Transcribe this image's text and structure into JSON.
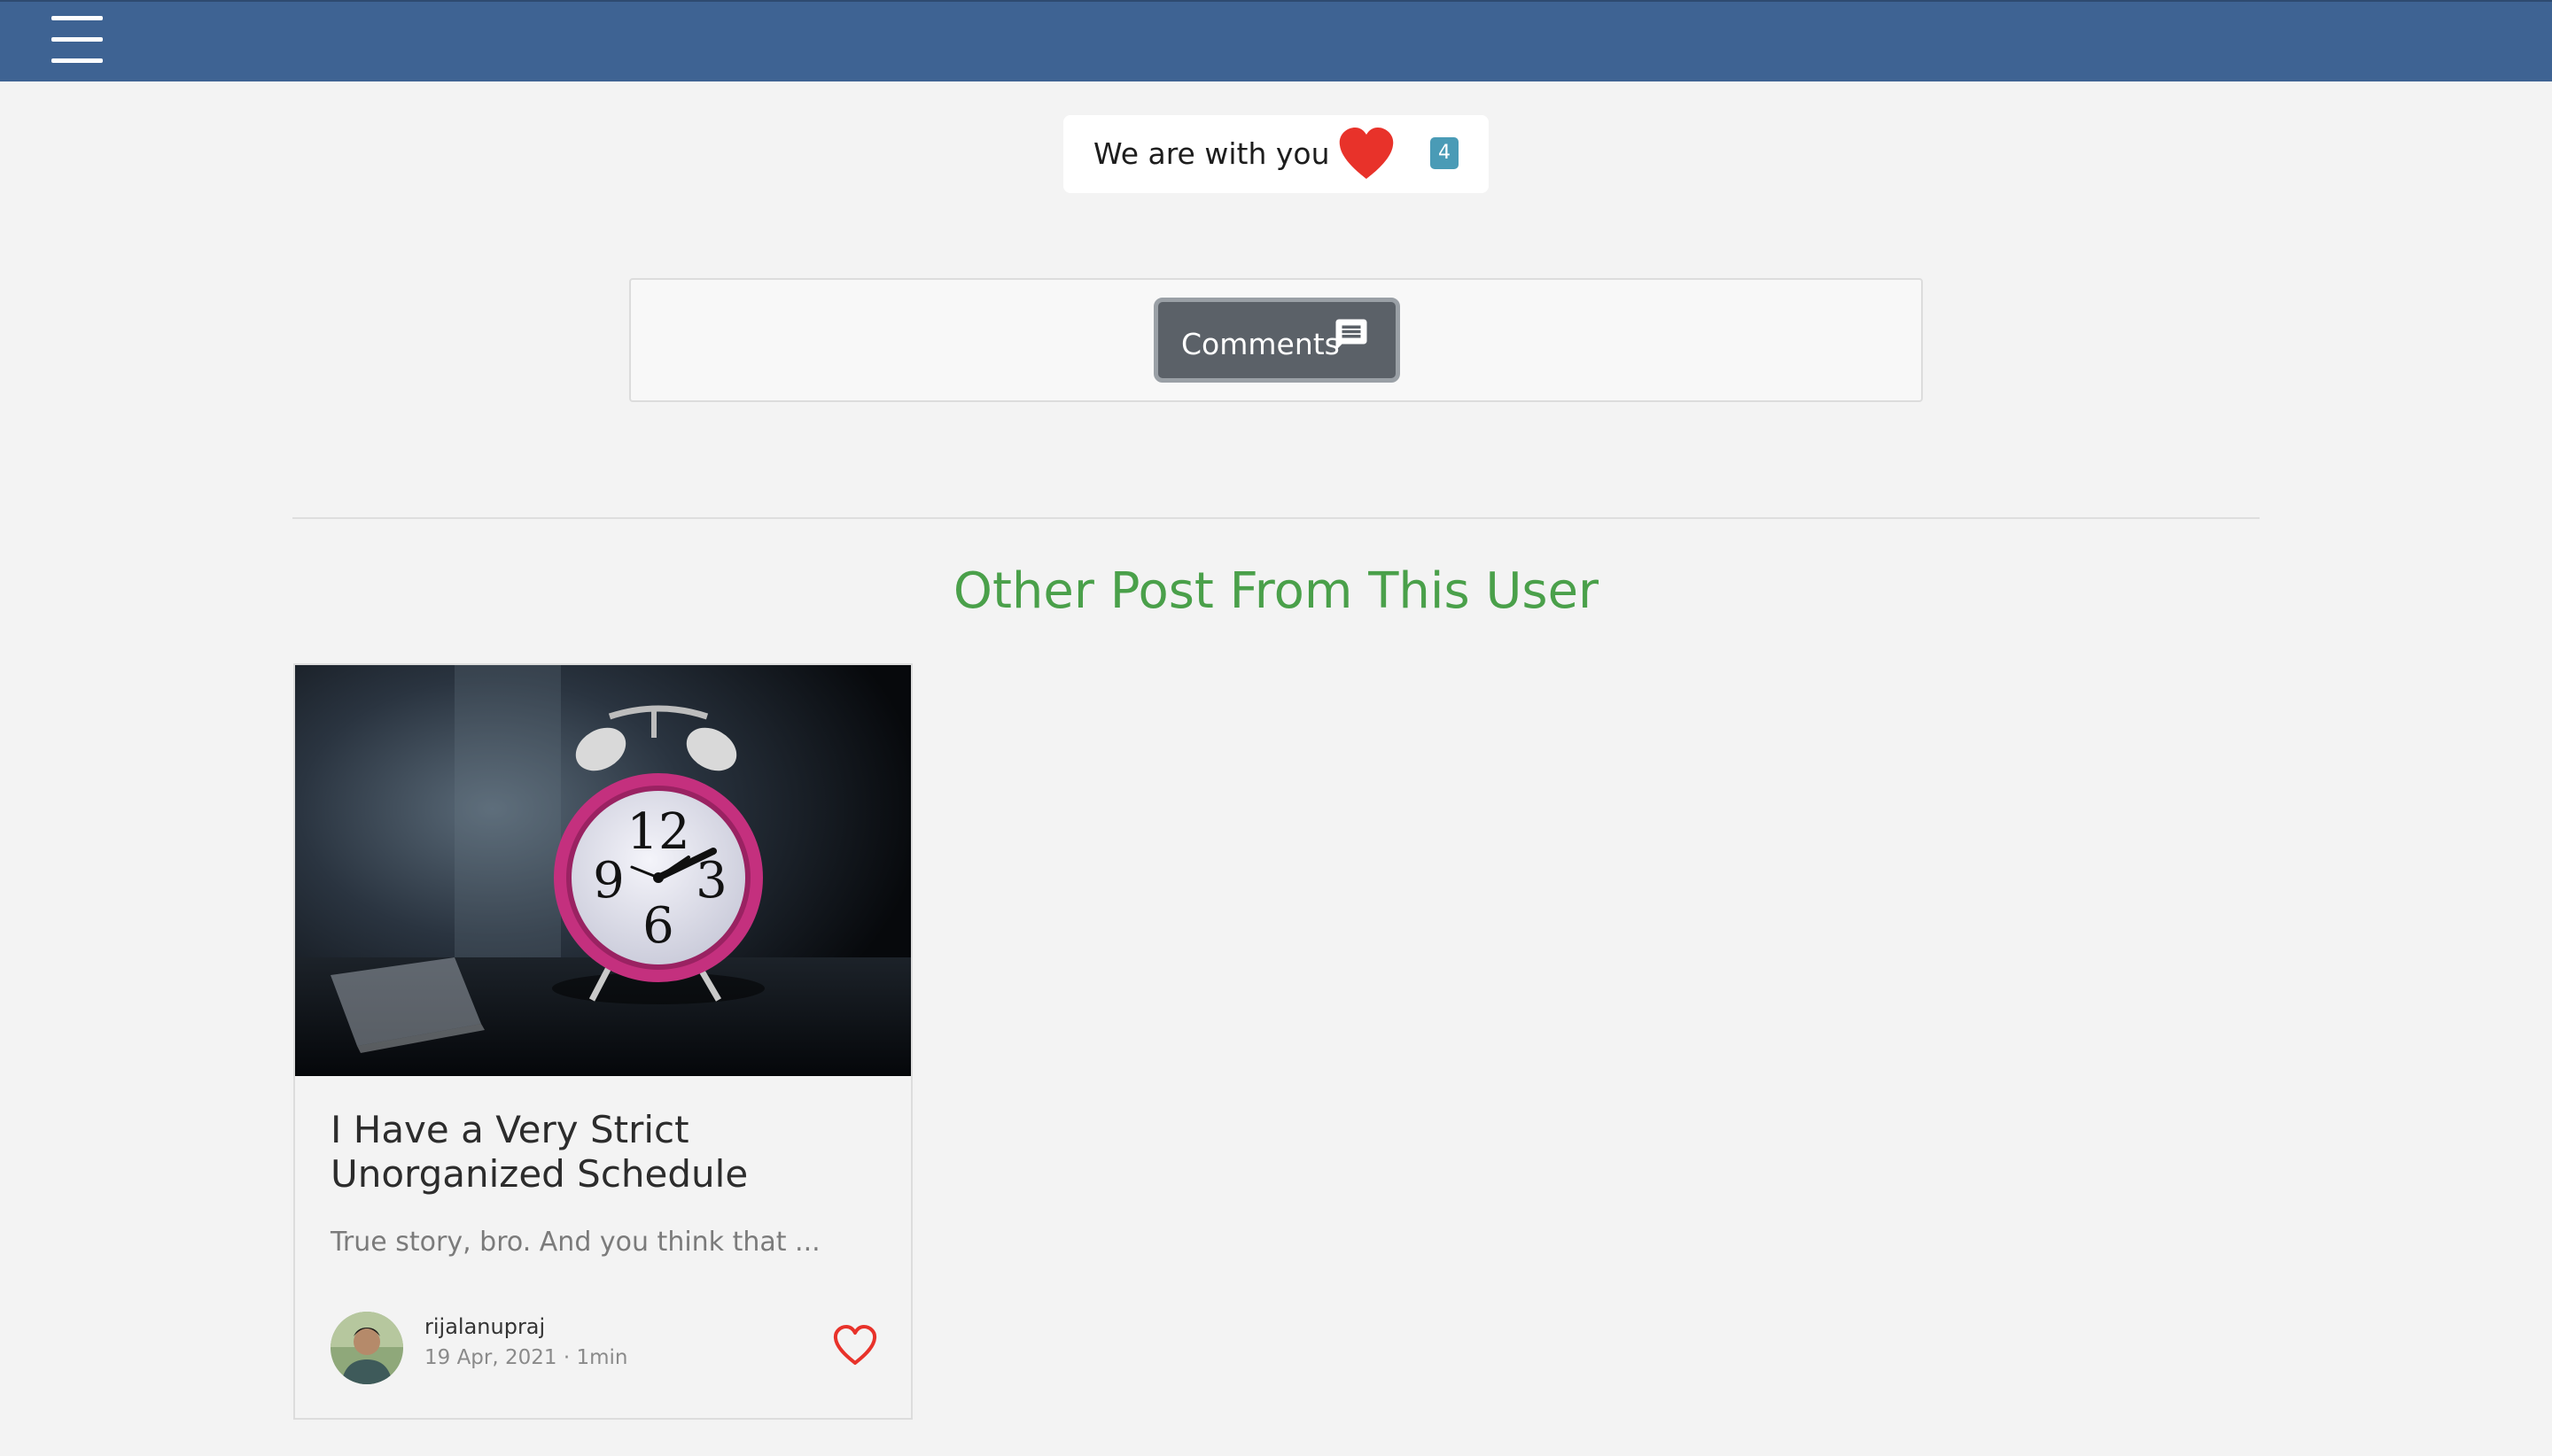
{
  "navbar": {
    "menu_icon": "hamburger-menu-icon",
    "background_color": "#3e6393"
  },
  "support": {
    "text": "We are with you",
    "heart_icon": "heart-filled-icon",
    "heart_color": "#e8322a",
    "count": "4",
    "badge_color": "#4a9bb6"
  },
  "comments": {
    "button_label": "Comments",
    "icon": "comment-bubble-icon"
  },
  "section": {
    "title": "Other Post From This User",
    "title_color": "#4aa04a"
  },
  "post": {
    "image_icon": "alarm-clock-photo",
    "title": "I Have a Very Strict Unorganized Schedule",
    "excerpt": "True story, bro. And you think that ...",
    "author": "rijalanupraj",
    "meta": "19 Apr, 2021 · 1min",
    "like_icon": "heart-outline-icon",
    "like_color": "#e8322a"
  }
}
